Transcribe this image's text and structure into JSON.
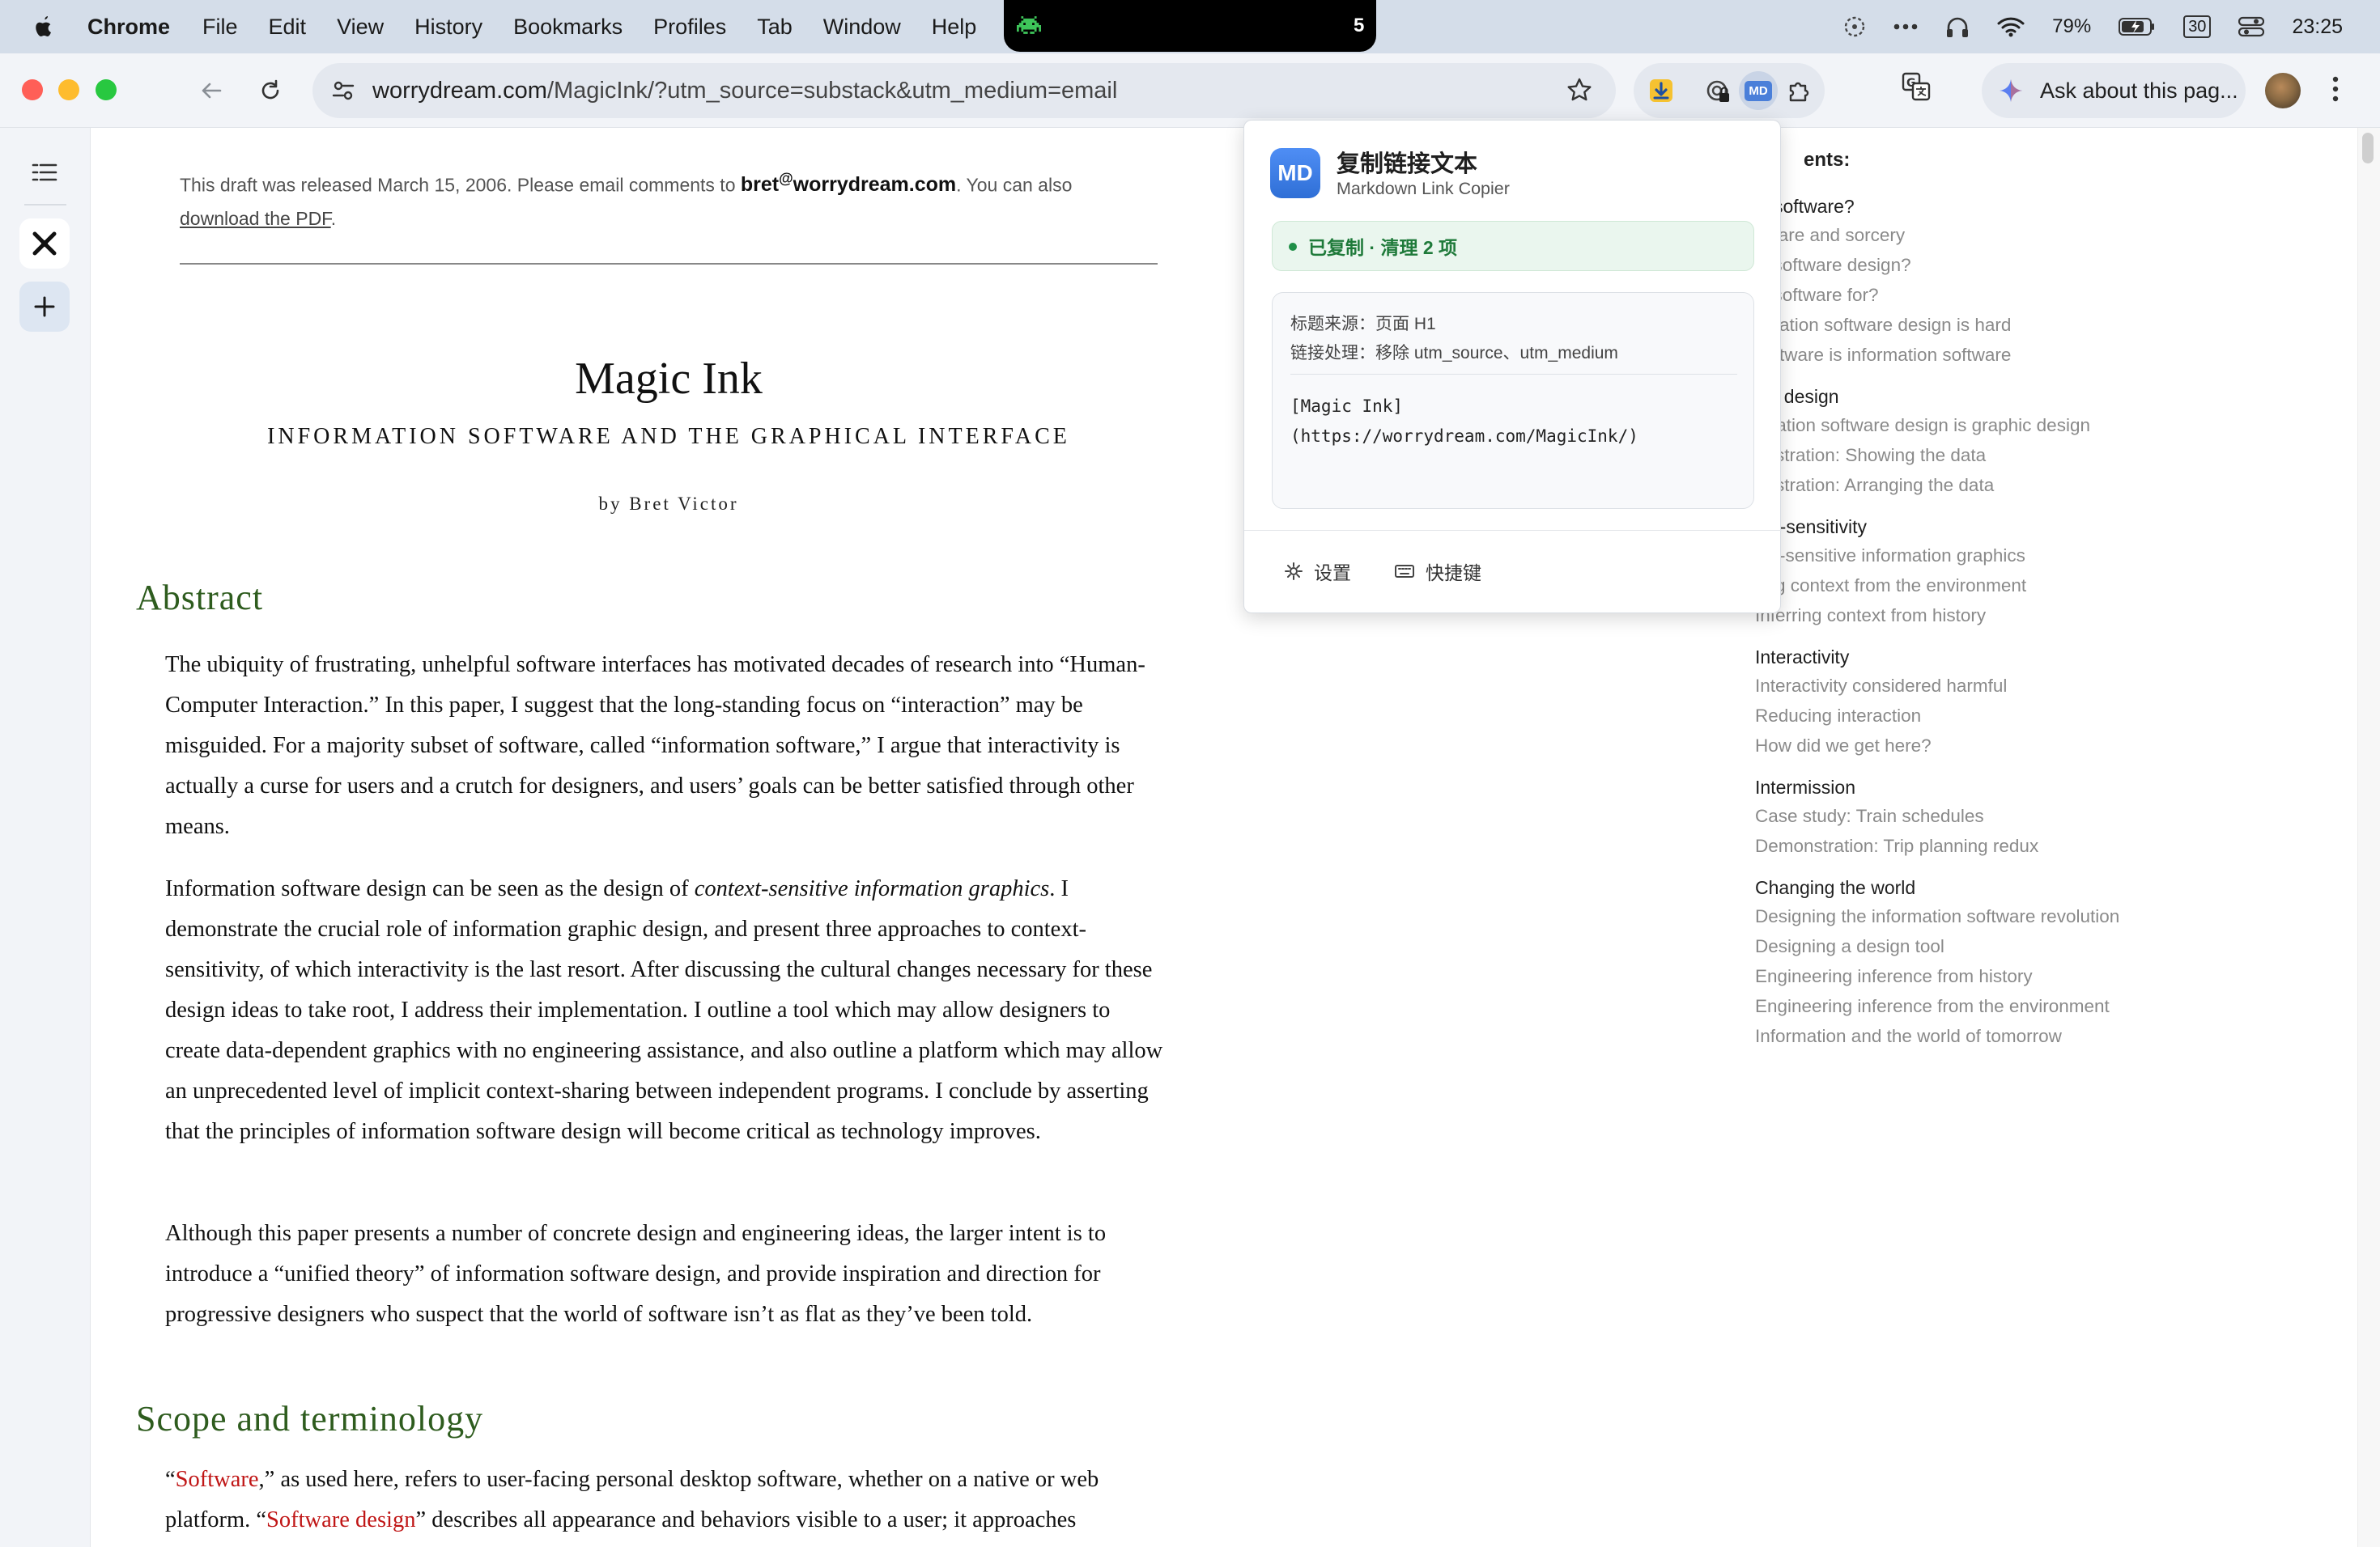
{
  "menubar": {
    "app": "Chrome",
    "items": [
      "File",
      "Edit",
      "View",
      "History",
      "Bookmarks",
      "Profiles",
      "Tab",
      "Window",
      "Help"
    ],
    "notch_number": "5",
    "battery": "79%",
    "date_badge": "30",
    "time": "23:25"
  },
  "toolbar": {
    "url_host": "worrydream.com",
    "url_rest": "/MagicInk/?utm_source=substack&utm_medium=email",
    "ask_label": "Ask about this pag...",
    "ext_md_label": "MD"
  },
  "page": {
    "draft_before": "This draft was released March 15, 2006. Please email comments to ",
    "email_user": "bret",
    "email_at": "@",
    "email_domain": "worrydream.com",
    "draft_after": ". You can also",
    "draft_link": "download the PDF",
    "draft_end": ".",
    "title": "Magic Ink",
    "subtitle": "INFORMATION SOFTWARE AND THE GRAPHICAL INTERFACE",
    "byline": "by Bret Victor",
    "h_abstract": "Abstract",
    "p1": "The ubiquity of frustrating, unhelpful software interfaces has motivated decades of research into “Human-Computer Interaction.” In this paper, I suggest that the long-standing focus on “interaction” may be misguided. For a majority subset of software, called “information software,” I argue that interactivity is actually a curse for users and a crutch for designers, and users’ goals can be better satisfied through other means.",
    "p2_a": "Information software design can be seen as the design of ",
    "p2_em": "context-sensitive information graphics",
    "p2_b": ". I demonstrate the crucial role of information graphic design, and present three approaches to context-sensitivity, of which interactivity is the last resort. After discussing the cultural changes necessary for these design ideas to take root, I address their implementation. I outline a tool which may allow designers to create data-dependent graphics with no engineering assistance, and also outline a platform which may allow an unprecedented level of implicit context-sharing between independent programs. I conclude by asserting that the principles of information software design will become critical as technology improves.",
    "p3": "Although this paper presents a number of concrete design and engineering ideas, the larger intent is to introduce a “unified theory” of information software design, and provide inspiration and direction for progressive designers who suspect that the world of software isn’t as flat as they’ve been told.",
    "h_scope": "Scope and terminology",
    "p4_q1": "“",
    "p4_t1": "Software",
    "p4_a": ",” as used here, refers to user-facing personal desktop software, whether on a native or web platform. “",
    "p4_t2": "Software design",
    "p4_b": "” describes all appearance and behaviors visible to a user; it approaches"
  },
  "toc": {
    "heading": "ents:",
    "sections": [
      {
        "title": " is software?",
        "items": [
          "ftware and sorcery",
          " is software design?",
          " is software for?",
          "pulation software design is hard",
          " software is information software"
        ]
      },
      {
        "title": "hic design",
        "items": [
          "rmation software design is graphic design",
          "onstration: Showing the data",
          "onstration: Arranging the data"
        ]
      },
      {
        "title": "ext-sensitivity",
        "items": [
          "ext-sensitive information graphics",
          "ring context from the environment",
          "Inferring context from history"
        ]
      },
      {
        "title": "Interactivity",
        "items": [
          "Interactivity considered harmful",
          "Reducing interaction",
          "How did we get here?"
        ]
      },
      {
        "title": "Intermission",
        "items": [
          "Case study: Train schedules",
          "Demonstration: Trip planning redux"
        ]
      },
      {
        "title": "Changing the world",
        "items": [
          "Designing the information software revolution",
          "Designing a design tool",
          "Engineering inference from history",
          "Engineering inference from the environment",
          "Information and the world of tomorrow"
        ]
      }
    ]
  },
  "popup": {
    "logo": "MD",
    "title": "复制链接文本",
    "subtitle": "Markdown Link Copier",
    "status": "已复制 · 清理 2 项",
    "meta1": "标题来源：页面 H1",
    "meta2": "链接处理：移除 utm_source、utm_medium",
    "code": "[Magic Ink]\n(https://worrydream.com/MagicInk/)",
    "settings": "设置",
    "shortcuts": "快捷键"
  }
}
